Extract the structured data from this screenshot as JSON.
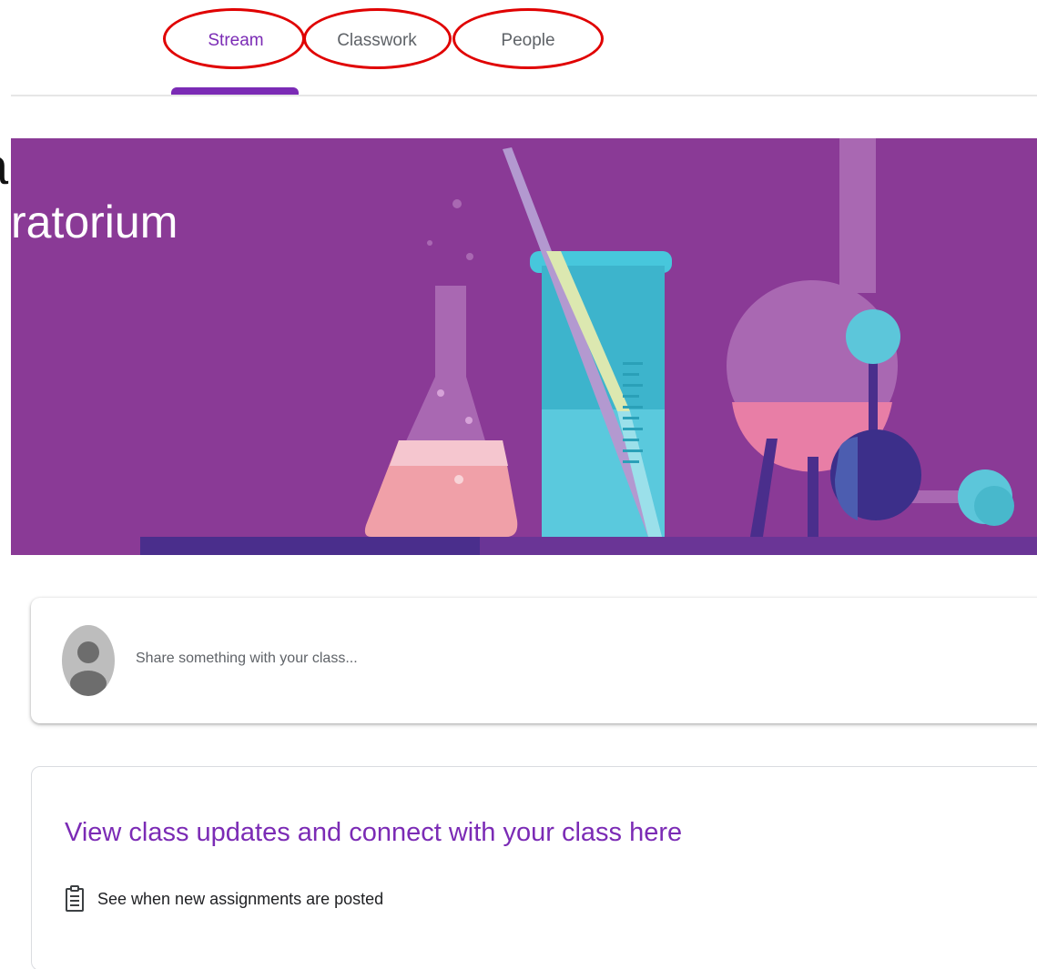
{
  "tabs": [
    {
      "label": "Stream",
      "active": true
    },
    {
      "label": "Classwork",
      "active": false
    },
    {
      "label": "People",
      "active": false
    }
  ],
  "banner": {
    "title": "ratorium",
    "background_color": "#8a3a96"
  },
  "share": {
    "placeholder": "Share something with your class..."
  },
  "updates": {
    "title": "View class updates and connect with your class here",
    "item": "See when new assignments are posted"
  },
  "colors": {
    "accent": "#7b2bb5",
    "annotation": "#e00000"
  }
}
